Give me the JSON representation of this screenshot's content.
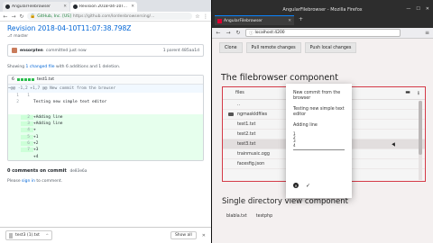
{
  "chrome": {
    "tabs": [
      {
        "label": "AngularFilebrowser"
      },
      {
        "label": "Revision 2018-04-10T..."
      }
    ],
    "url_secure": "GitHub, Inc. [US]",
    "url_rest": "https://github.com/lordenbrowsersing/..."
  },
  "github": {
    "title": "Revision 2018-04-10T11:07:38.798Z",
    "branch": "master",
    "author": "ensorpten",
    "committed": "committed just now",
    "parent": "1 parent  485aa1d",
    "summary_pre": "Showing",
    "summary_link": "1 changed file",
    "summary_post": "with 6 additions and 1 deletion.",
    "file_count": "6",
    "file_name": "test1.txt",
    "hunk": "@@ -1,2 +1,7 @@ New commit from the browser",
    "ctx_lines": [
      {
        "n1": "1",
        "n2": "1",
        "text": ""
      },
      {
        "n1": "2",
        "n2": "",
        "text": "Testing new simple text editor"
      }
    ],
    "add_lines": [
      {
        "n": "2",
        "text": "+Adding line"
      },
      {
        "n": "3",
        "text": "+Adding line"
      },
      {
        "n": "4",
        "text": "+"
      },
      {
        "n": "5",
        "text": "+1"
      },
      {
        "n": "6",
        "text": "+2"
      },
      {
        "n": "7",
        "text": "+3"
      },
      {
        "n": "",
        "text": "+4"
      }
    ],
    "comments_title": "0 comments on commit",
    "comments_sha": "de83e6a",
    "signin_pre": "Please",
    "signin_link": "sign in",
    "signin_post": "to comment."
  },
  "downloads": {
    "item": "test3 (1).txt",
    "show_all": "Show all"
  },
  "firefox": {
    "window_title": "AngularFilebrowser - Mozilla Firefox",
    "tab_label": "AngularFilebrowser",
    "url": "localhost:4200"
  },
  "app": {
    "buttons": [
      "Clone",
      "Pull remote changes",
      "Push local changes"
    ],
    "filebrowser_title": "The filebrowser component",
    "files_header": "files",
    "rows": [
      "..",
      "ngmaskldfiles",
      "test1.txt",
      "test2.txt",
      "test3.txt",
      "trainmusic.ogg",
      "facesfig.json"
    ],
    "selected_index": 4,
    "single_title": "Single directory view component",
    "single_files": [
      "blabla.txt",
      "testphp"
    ]
  },
  "dialog": {
    "title": "New commit from the browser",
    "body": "Testing new simple text editor",
    "adding": "Adding line",
    "editor_lines": [
      "1",
      "2",
      "3",
      "4"
    ]
  }
}
